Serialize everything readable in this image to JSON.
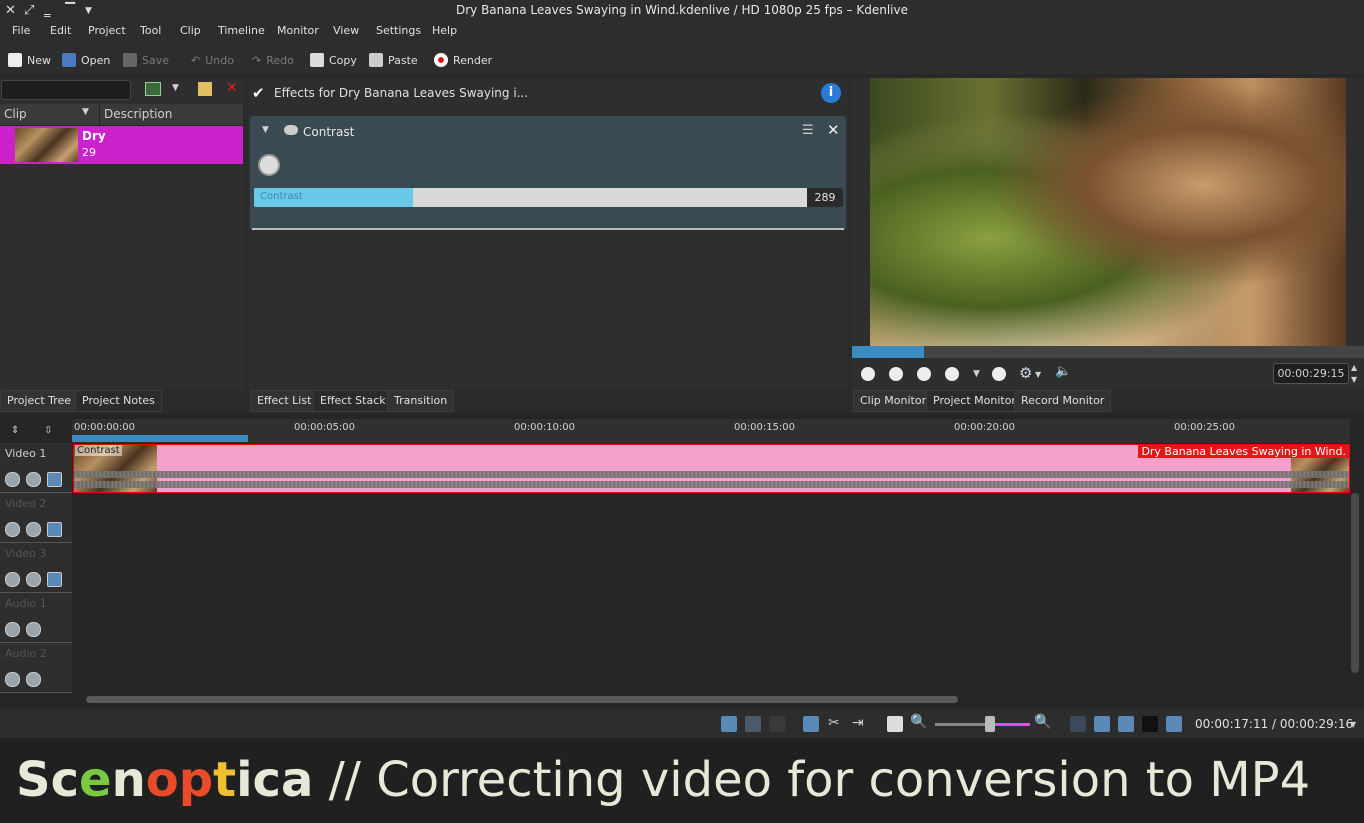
{
  "window": {
    "title": "Dry Banana Leaves Swaying in Wind.kdenlive / HD 1080p 25 fps – Kdenlive"
  },
  "menu": [
    "File",
    "Edit",
    "Project",
    "Tool",
    "Clip",
    "Timeline",
    "Monitor",
    "View",
    "Settings",
    "Help"
  ],
  "toolbar": {
    "new": "New",
    "open": "Open",
    "save": "Save",
    "undo": "Undo",
    "redo": "Redo",
    "copy": "Copy",
    "paste": "Paste",
    "render": "Render"
  },
  "project_tree": {
    "col_clip": "Clip",
    "col_description": "Description",
    "clip_name": "Dry",
    "clip_duration": "29"
  },
  "effects": {
    "enabled_label": "Effects for Dry Banana Leaves Swaying i...",
    "effect_name": "Contrast",
    "param_label": "Contrast",
    "param_value": "289",
    "param_fraction": 0.27
  },
  "monitor": {
    "timecode": "00:00:29:15",
    "zone_fraction": 0.14
  },
  "tabs": {
    "project_tree": "Project Tree",
    "project_notes": "Project Notes",
    "effect_list": "Effect List",
    "effect_stack": "Effect Stack",
    "transition": "Transition",
    "clip_monitor": "Clip Monitor",
    "project_monitor": "Project Monitor",
    "record_monitor": "Record Monitor"
  },
  "timeline": {
    "ruler": [
      "00:00:00:00",
      "00:00:05:00",
      "00:00:10:00",
      "00:00:15:00",
      "00:00:20:00",
      "00:00:25:00"
    ],
    "tracks": [
      "Video 1",
      "Video 2",
      "Video 3",
      "Audio 1",
      "Audio 2"
    ],
    "clip_name": "Dry Banana Leaves Swaying in Wind.",
    "clip_effect": "Contrast"
  },
  "status": {
    "timecode": "00:00:17:11 / 00:00:29:16"
  },
  "caption": {
    "brand": "Scenoptica",
    "text": " // Correcting video for conversion to MP4"
  }
}
